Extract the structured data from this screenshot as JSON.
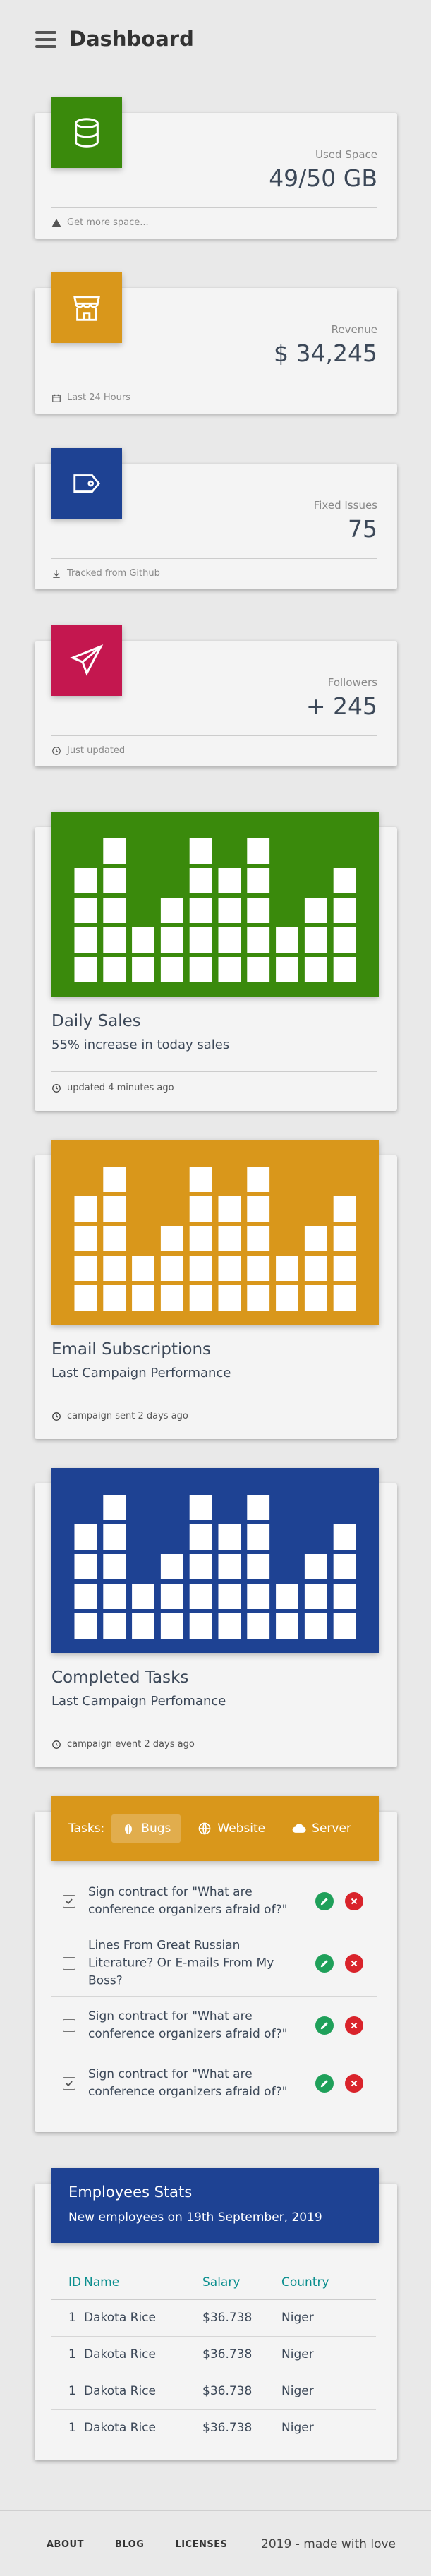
{
  "header": {
    "title": "Dashboard"
  },
  "stats": [
    {
      "label": "Used Space",
      "value": "49/50 GB",
      "footer": "Get more space...",
      "color": "#3a8a0c",
      "icon": "database-icon",
      "footer_icon": "warning-icon"
    },
    {
      "label": "Revenue",
      "value": "$ 34,245",
      "footer": "Last 24 Hours",
      "color": "#d9971b",
      "icon": "store-icon",
      "footer_icon": "calendar-icon"
    },
    {
      "label": "Fixed Issues",
      "value": "75",
      "footer": "Tracked from Github",
      "color": "#1e4293",
      "icon": "tag-icon",
      "footer_icon": "download-icon"
    },
    {
      "label": "Followers",
      "value": "+ 245",
      "footer": "Just updated",
      "color": "#c4174f",
      "icon": "paper-plane-icon",
      "footer_icon": "clock-icon"
    }
  ],
  "charts": [
    {
      "title": "Daily Sales",
      "subtitle": "55% increase in today sales",
      "footer": "updated 4 minutes ago",
      "color": "#3a8a0c"
    },
    {
      "title": "Email Subscriptions",
      "subtitle": "Last Campaign Performance",
      "footer": "campaign sent 2 days ago",
      "color": "#d9971b"
    },
    {
      "title": "Completed Tasks",
      "subtitle": "Last Campaign Perfomance",
      "footer": "campaign event 2 days ago",
      "color": "#1e4293"
    }
  ],
  "chart_data": {
    "type": "bar",
    "note_series": "equalizer-style decorative bars, stacked block counts per column",
    "values": [
      4,
      5,
      2,
      3,
      5,
      4,
      5,
      2,
      3,
      4
    ]
  },
  "tasks": {
    "label": "Tasks:",
    "tabs": [
      {
        "label": "Bugs",
        "icon": "bug-icon",
        "active": true
      },
      {
        "label": "Website",
        "icon": "globe-icon",
        "active": false
      },
      {
        "label": "Server",
        "icon": "cloud-icon",
        "active": false
      }
    ],
    "items": [
      {
        "text": "Sign contract for \"What are conference organizers afraid of?\"",
        "checked": true
      },
      {
        "text": "Lines From Great Russian Literature? Or E-mails From My Boss?",
        "checked": false
      },
      {
        "text": "Sign contract for \"What are conference organizers afraid of?\"",
        "checked": false
      },
      {
        "text": "Sign contract for \"What are conference organizers afraid of?\"",
        "checked": true
      }
    ]
  },
  "employees": {
    "title": "Employees Stats",
    "subtitle": "New employees on 19th September, 2019",
    "columns": [
      "ID",
      "Name",
      "Salary",
      "Country"
    ],
    "rows": [
      [
        "1",
        "Dakota Rice",
        "$36.738",
        "Niger"
      ],
      [
        "1",
        "Dakota Rice",
        "$36.738",
        "Niger"
      ],
      [
        "1",
        "Dakota Rice",
        "$36.738",
        "Niger"
      ],
      [
        "1",
        "Dakota Rice",
        "$36.738",
        "Niger"
      ]
    ]
  },
  "footer": {
    "links": [
      "ABOUT",
      "BLOG",
      "LICENSES"
    ],
    "copyright": "2019 - made with love"
  }
}
